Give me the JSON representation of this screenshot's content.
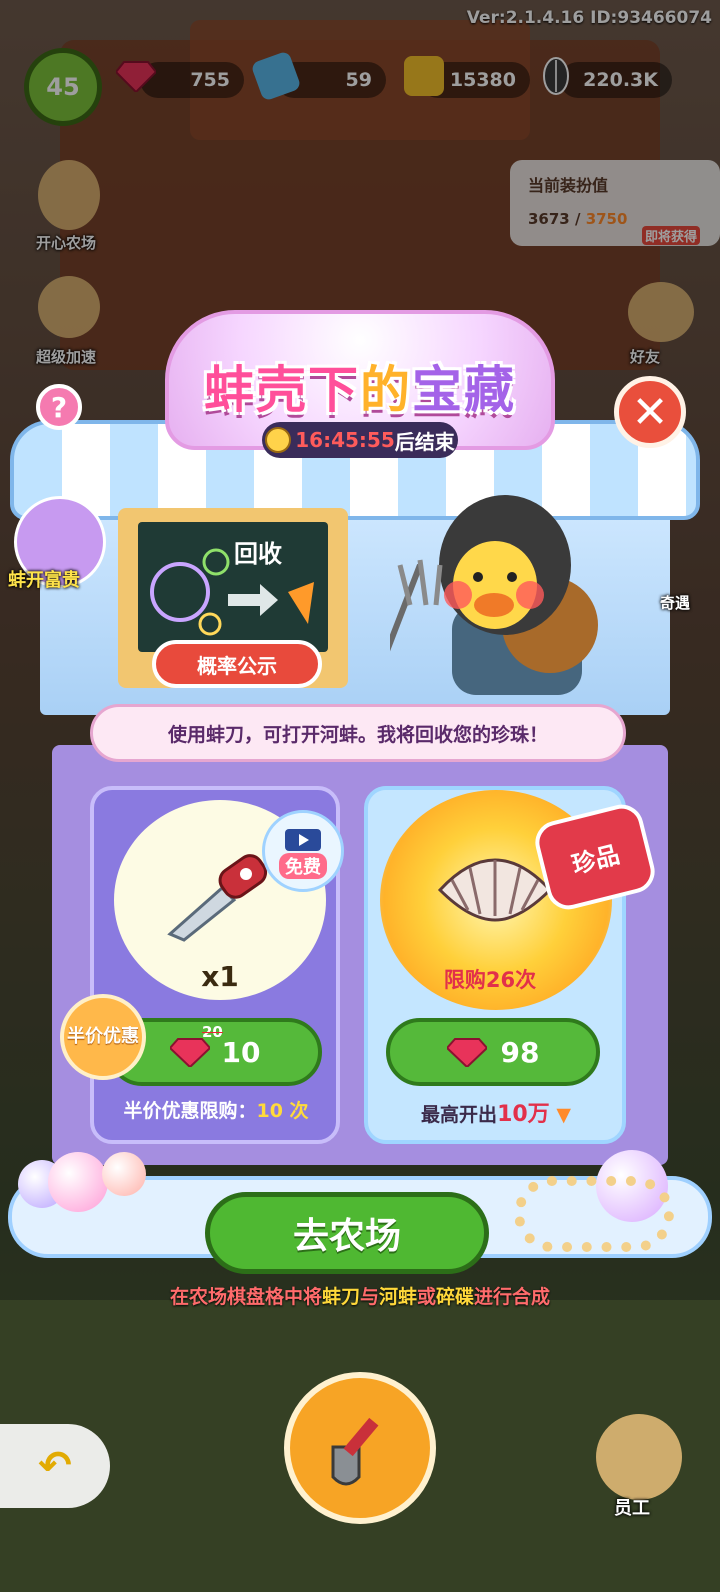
{
  "hud": {
    "version_text": "Ver:2.1.4.16 ID:93466074",
    "level": "45",
    "gems": "755",
    "tickets": "59",
    "coins": "15380",
    "seeds": "220.3K"
  },
  "side_menu": {
    "happy_farm": "开心农场",
    "super_speed": "超级加速",
    "friends": "好友",
    "encounter": "奇遇",
    "pearl_event": "蚌开富贵"
  },
  "dress_panel": {
    "title": "当前装扮值",
    "current": "3673",
    "target": "3750",
    "badge": "即将获得"
  },
  "popup": {
    "title_part1": "蚌壳下",
    "title_part2": "的",
    "title_part3": "宝藏",
    "timer_value": "16:45:55",
    "timer_suffix": "后结束",
    "help_label": "?",
    "close_label": "✕",
    "board_text": "回收",
    "odds_button": "概率公示",
    "message": "使用蚌刀，可打开河蚌。我将回收您的珍珠！",
    "left_card": {
      "free_badge": "免费",
      "quantity": "x1",
      "half_badge": "半价优惠",
      "old_price": "20",
      "price": "10",
      "limit_label": "半价优惠限购：",
      "limit_value": "10 次"
    },
    "right_card": {
      "treasure_badge": "珍品",
      "limit_text": "限购26次",
      "price": "98",
      "max_prefix": "最高开出",
      "max_value": "10万"
    },
    "go_button": "去农场",
    "hint_parts": [
      "在农场棋盘格中将",
      "蚌刀",
      "与",
      "河蚌",
      "或",
      "碎碟",
      "进行合成"
    ]
  },
  "bottom": {
    "back_label": "↶",
    "staff_label": "员工"
  },
  "colors": {
    "title_pink": "#ff4f9a",
    "green_button": "#55b93a",
    "gem_red": "#e8335a",
    "hint_red": "#ff6b6b"
  }
}
